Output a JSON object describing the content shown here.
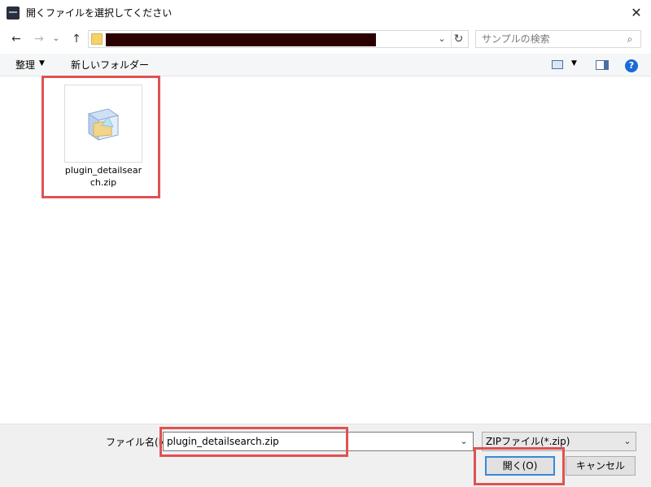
{
  "window": {
    "title": "開くファイルを選択してください",
    "close_glyph": "✕"
  },
  "nav": {
    "back": "←",
    "forward": "→",
    "recent": "⌄",
    "up": "↑",
    "address_dropdown": "⌄",
    "refresh": "↻"
  },
  "search": {
    "placeholder": "サンプルの検索",
    "icon": "⌕"
  },
  "toolbar": {
    "organize": "整理",
    "organize_caret": "▼",
    "new_folder": "新しいフォルダー",
    "view_caret": "▼",
    "help": "?"
  },
  "files": [
    {
      "name": "plugin_detailsearch.zip"
    }
  ],
  "footer": {
    "filename_label": "ファイル名(N):",
    "filename_value": "plugin_detailsearch.zip",
    "filename_dropdown": "⌄",
    "filter": "ZIPファイル(*.zip)",
    "filter_dropdown": "⌄",
    "open_label": "開く(O)",
    "cancel_label": "キャンセル"
  },
  "colors": {
    "highlight": "#e05252",
    "accent": "#3a88d8"
  }
}
